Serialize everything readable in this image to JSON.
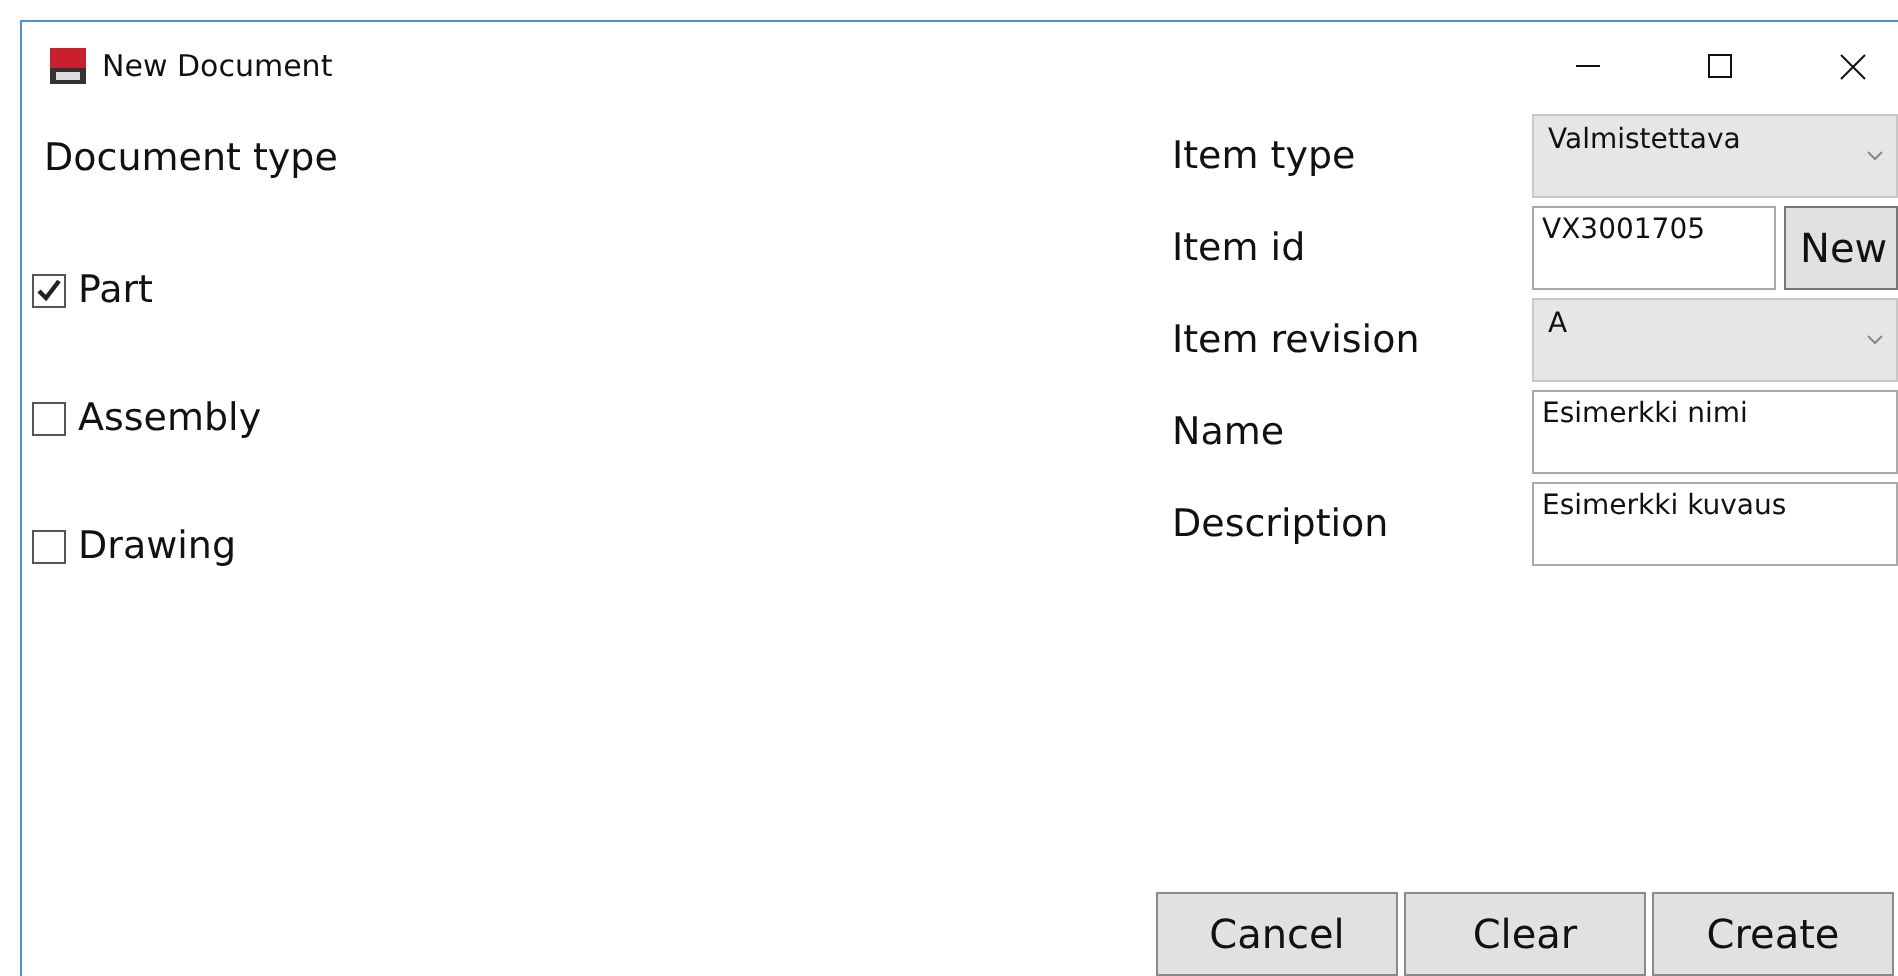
{
  "window": {
    "title": "New Document"
  },
  "document_type": {
    "label": "Document type",
    "options": [
      {
        "label": "Part",
        "checked": true
      },
      {
        "label": "Assembly",
        "checked": false
      },
      {
        "label": "Drawing",
        "checked": false
      }
    ]
  },
  "fields": [
    {
      "kind": "dropdown",
      "label": "Item type",
      "value": "Valmistettava"
    },
    {
      "kind": "text",
      "label": "Item id",
      "value": "VX3001705",
      "button": "New"
    },
    {
      "kind": "dropdown",
      "label": "Item revision",
      "value": "A"
    },
    {
      "kind": "text",
      "label": "Name",
      "value": "Esimerkki nimi"
    },
    {
      "kind": "text",
      "label": "Description",
      "value": "Esimerkki kuvaus"
    }
  ],
  "buttons": [
    "Cancel",
    "Clear",
    "Create"
  ]
}
